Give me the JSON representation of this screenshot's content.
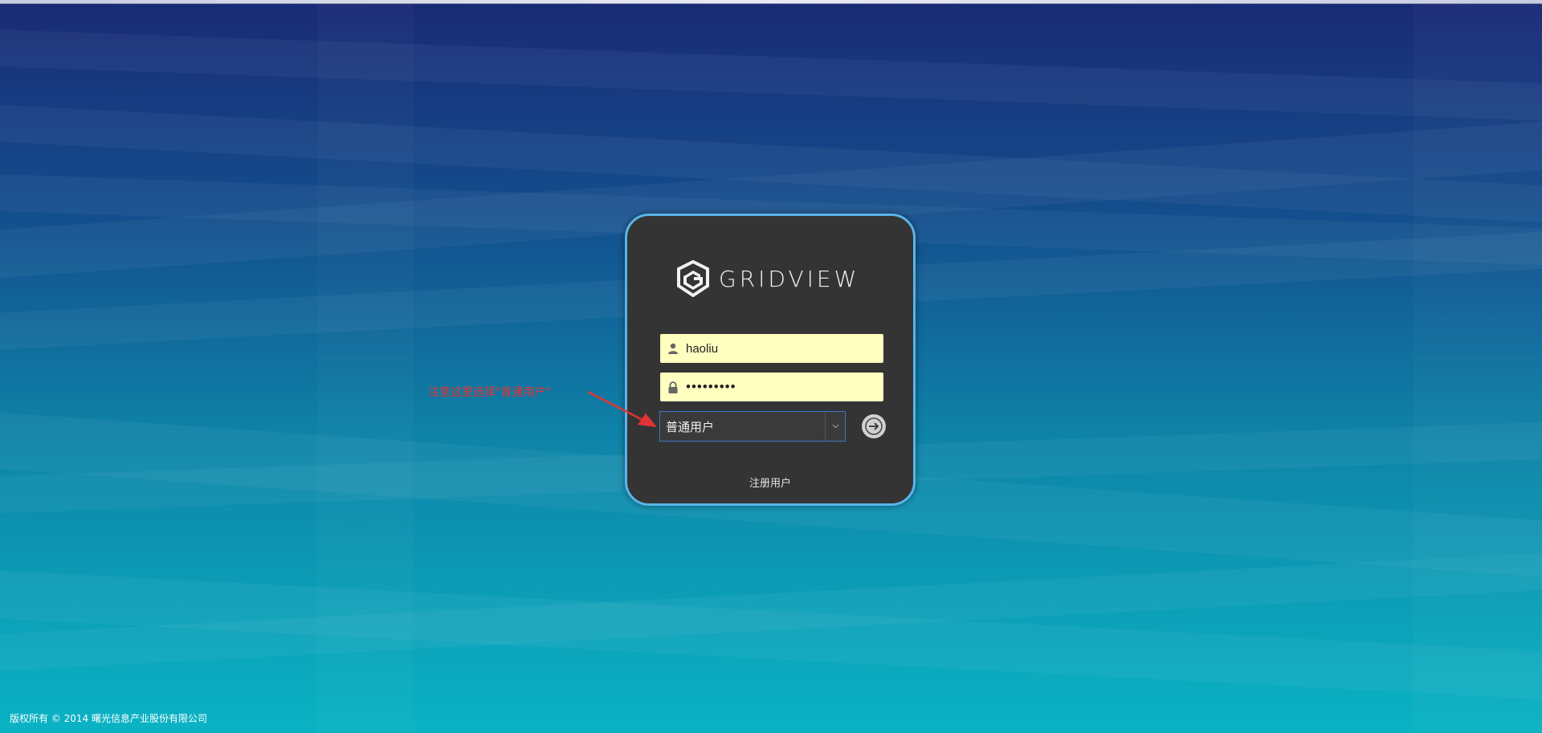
{
  "brand": {
    "logo_text": "GRIDVIEW"
  },
  "login": {
    "username_value": "haoliu",
    "password_value": "•••••••••",
    "user_type_selected": "普通用户",
    "register_label": "注册用户",
    "submit_icon": "arrow-right-icon"
  },
  "annotation": {
    "text": "注意这里选择\"普通用户\""
  },
  "footer": {
    "copyright": "版权所有 © 2014 曙光信息产业股份有限公司"
  },
  "colors": {
    "card_background": "#343434",
    "card_border": "#5ab4e8",
    "field_background": "#ffffc0",
    "annotation": "#e23434",
    "select_border": "#3b78c9"
  }
}
